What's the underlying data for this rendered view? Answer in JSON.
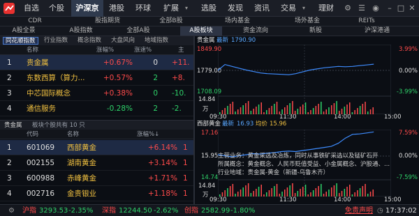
{
  "topnav": {
    "items": [
      "自选",
      "个股",
      "沪深京",
      "港股",
      "环球",
      "扩展",
      "选股",
      "发现",
      "资讯",
      "交易",
      "理财"
    ],
    "active_index": 2
  },
  "row2": [
    "CDR",
    "股指期货",
    "全部B股",
    "场内基金",
    "场外基金",
    "REITs"
  ],
  "row3": [
    "A股全景",
    "A股指数",
    "全部A股",
    "A股板块",
    "资金流向",
    "新股",
    "沪深港通"
  ],
  "row3_active": 3,
  "left_tabs": [
    "同花顺指数",
    "行业指数",
    "概念指数",
    "大盘风向",
    "地域指数"
  ],
  "sector_header": {
    "name": "名称",
    "change": "涨幅%",
    "speed": "涨速%",
    "extra": "主"
  },
  "sectors": [
    {
      "rank": "1",
      "name": "贵金属",
      "change": "+0.67%",
      "speed": "0",
      "extra": "+11."
    },
    {
      "rank": "2",
      "name": "东数西算（算力...",
      "change": "+0.57%",
      "speed": "2",
      "extra": "+8."
    },
    {
      "rank": "3",
      "name": "中芯国际概念",
      "change": "+0.38%",
      "speed": "0",
      "extra": "-10."
    },
    {
      "rank": "4",
      "name": "通信服务",
      "change": "-0.28%",
      "speed": "2",
      "extra": "-2."
    }
  ],
  "sec2_title": "贵金属",
  "sec2_note": "板块个股共有 10 只",
  "stock_header": {
    "code": "代码",
    "name": "名称",
    "change": "涨幅%↓"
  },
  "stocks": [
    {
      "rank": "1",
      "code": "601069",
      "name": "西部黄金",
      "change": "+6.14%"
    },
    {
      "rank": "2",
      "code": "002155",
      "name": "湖南黄金",
      "change": "+3.14%"
    },
    {
      "rank": "3",
      "code": "600988",
      "name": "赤峰黄金",
      "change": "+1.71%"
    },
    {
      "rank": "4",
      "code": "002716",
      "name": "金贵银业",
      "change": "+1.18%"
    }
  ],
  "chart1": {
    "name": "贵金属",
    "latest_label": "最新",
    "latest_value": "1790.90",
    "y_high": "1849.90",
    "y_mid": "1779.00",
    "y_low": "1708.09",
    "pct_high": "3.99%",
    "pct_mid": "0.00%",
    "pct_low": "-3.99%",
    "vol_top": "14.84",
    "vol_unit": "万",
    "times": [
      "09:30",
      "11:30",
      "14:00",
      "15:00"
    ],
    "chart_data": {
      "type": "line",
      "series": [
        {
          "values": [
            1779,
            1795,
            1790,
            1785,
            1780,
            1776,
            1772,
            1770,
            1769,
            1768,
            1767,
            1770,
            1775,
            1780,
            1783,
            1786,
            1788,
            1790,
            1789,
            1790,
            1792,
            1794,
            1796
          ]
        }
      ],
      "ylim": [
        1708.09,
        1849.9
      ]
    }
  },
  "chart2": {
    "name": "西部黄金",
    "latest_label": "最新",
    "latest_value": "16.93",
    "avg_label": "均价",
    "avg_value": "15.96",
    "y_high": "17.16",
    "y_mid": "15.95",
    "y_low": "14.74",
    "pct_high": "7.59%",
    "pct_mid": "0.00%",
    "pct_low": "-7.59%",
    "vol_top": "14.84",
    "vol_unit": "万",
    "times": [
      "09:30",
      "11:30",
      "14:00",
      "15:00"
    ],
    "info_lines": [
      "主营业务：黄金采选及冶炼，同时从事铁矿采选以及锰矿石开",
      "所属概念：黄金概念、人民币贬值受益、小金属概念、沪股通、...",
      "行业地域：贵金属-黄金（新疆-乌鲁木齐）"
    ],
    "chart_data": {
      "type": "line",
      "series": [
        {
          "values": [
            15.95,
            15.9,
            15.85,
            15.9,
            15.95,
            16.0,
            15.98,
            16.02,
            16.05,
            16.1,
            16.12,
            16.1,
            16.15,
            16.2,
            16.25,
            16.3,
            16.35,
            16.5,
            16.75,
            16.93,
            16.95,
            17.0,
            17.05
          ]
        }
      ],
      "ylim": [
        14.74,
        17.16
      ]
    }
  },
  "status": {
    "sh_label": "沪指",
    "sh_value": "3293.53",
    "sh_change": "-2.35%",
    "sz_label": "深指",
    "sz_value": "12244.50",
    "sz_change": "-2.62%",
    "cy_label": "创指",
    "cy_value": "2582.99",
    "cy_change": "-1.80%",
    "disclaimer": "免责声明",
    "time": "17:37:02"
  },
  "colors": {
    "up": "#ff4b4b",
    "down": "#2fd46a",
    "line": "#3e8cff",
    "accent": "#2f3a4d"
  }
}
